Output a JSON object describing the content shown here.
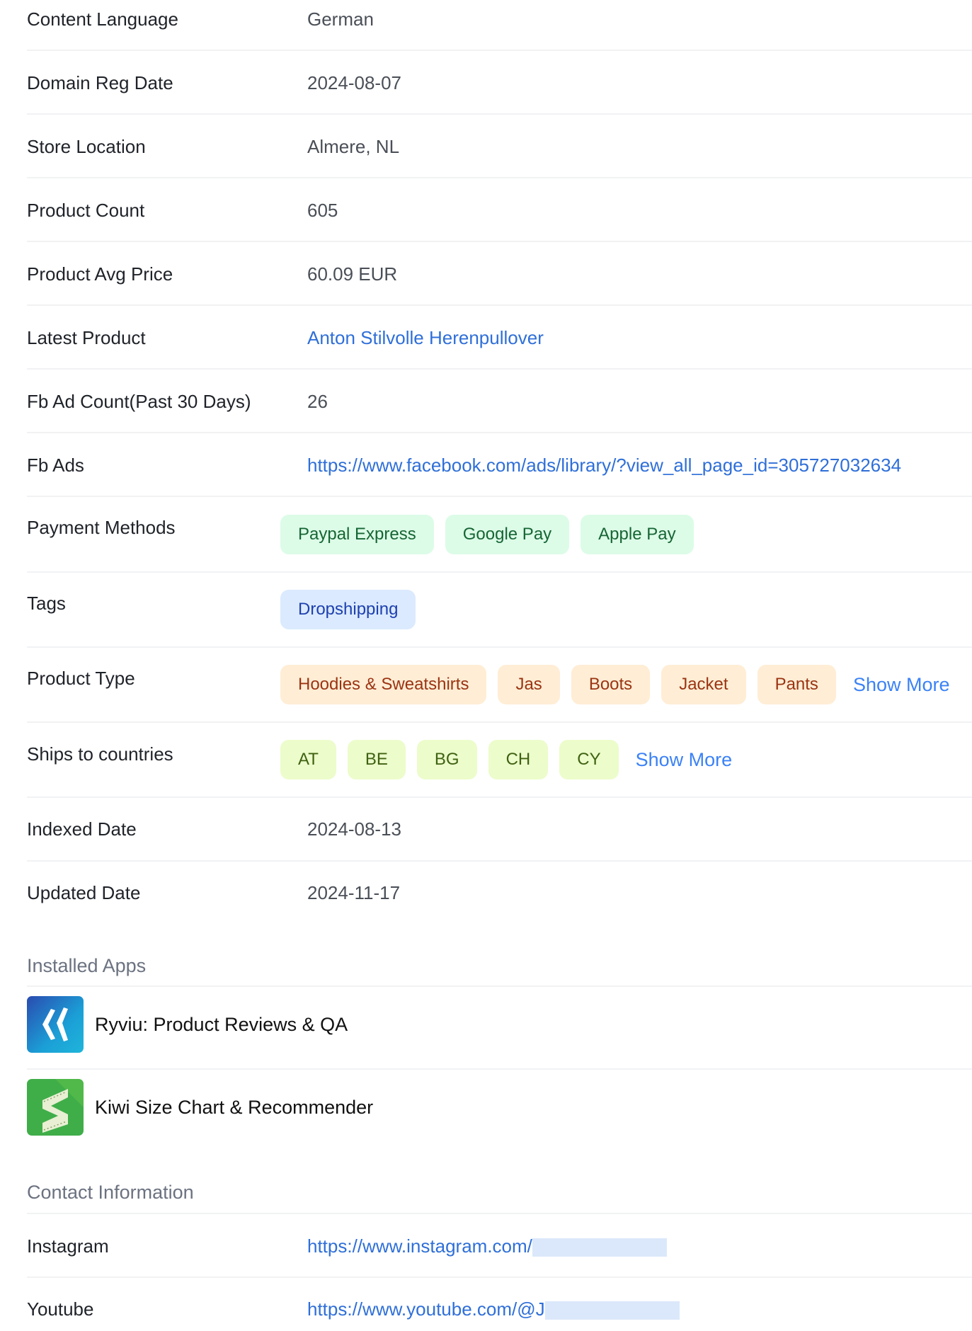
{
  "details": [
    {
      "label": "Content Language",
      "value": "German"
    },
    {
      "label": "Domain Reg Date",
      "value": "2024-08-07"
    },
    {
      "label": "Store Location",
      "value": "Almere,  NL"
    },
    {
      "label": "Product Count",
      "value": "605"
    },
    {
      "label": "Product Avg Price",
      "value": "60.09 EUR"
    },
    {
      "label": "Latest Product",
      "value": "Anton Stilvolle Herenpullover"
    },
    {
      "label": "Fb Ad Count(Past 30 Days)",
      "value": "26"
    },
    {
      "label": "Fb Ads",
      "value": "https://www.facebook.com/ads/library/?view_all_page_id=305727032634"
    }
  ],
  "payment_methods": {
    "label": "Payment Methods",
    "items": [
      "Paypal Express",
      "Google Pay",
      "Apple Pay"
    ]
  },
  "tags": {
    "label": "Tags",
    "items": [
      "Dropshipping"
    ]
  },
  "product_type": {
    "label": "Product Type",
    "items": [
      "Hoodies & Sweatshirts",
      "Jas",
      "Boots",
      "Jacket",
      "Pants"
    ],
    "show_more": "Show More"
  },
  "ships_to": {
    "label": "Ships to countries",
    "items": [
      "AT",
      "BE",
      "BG",
      "CH",
      "CY"
    ],
    "show_more": "Show More"
  },
  "indexed_date": {
    "label": "Indexed Date",
    "value": "2024-08-13"
  },
  "updated_date": {
    "label": "Updated Date",
    "value": "2024-11-17"
  },
  "installed_apps": {
    "title": "Installed Apps",
    "apps": [
      {
        "name": "Ryviu: Product Reviews & QA",
        "icon": "ryviu-logo-icon"
      },
      {
        "name": "Kiwi Size Chart & Recommender",
        "icon": "kiwi-size-chart-logo-icon"
      }
    ]
  },
  "contact": {
    "title": "Contact Information",
    "items": [
      {
        "label": "Instagram",
        "value": "https://www.instagram.com/"
      },
      {
        "label": "Youtube",
        "value": "https://www.youtube.com/@J"
      }
    ]
  },
  "colors": {
    "link": "#2f6fd8",
    "payment_pill_bg": "#dcfce7",
    "tag_pill_bg": "#dbeafe",
    "product_type_pill_bg": "#ffedd5",
    "country_pill_bg": "#ecfccb"
  }
}
